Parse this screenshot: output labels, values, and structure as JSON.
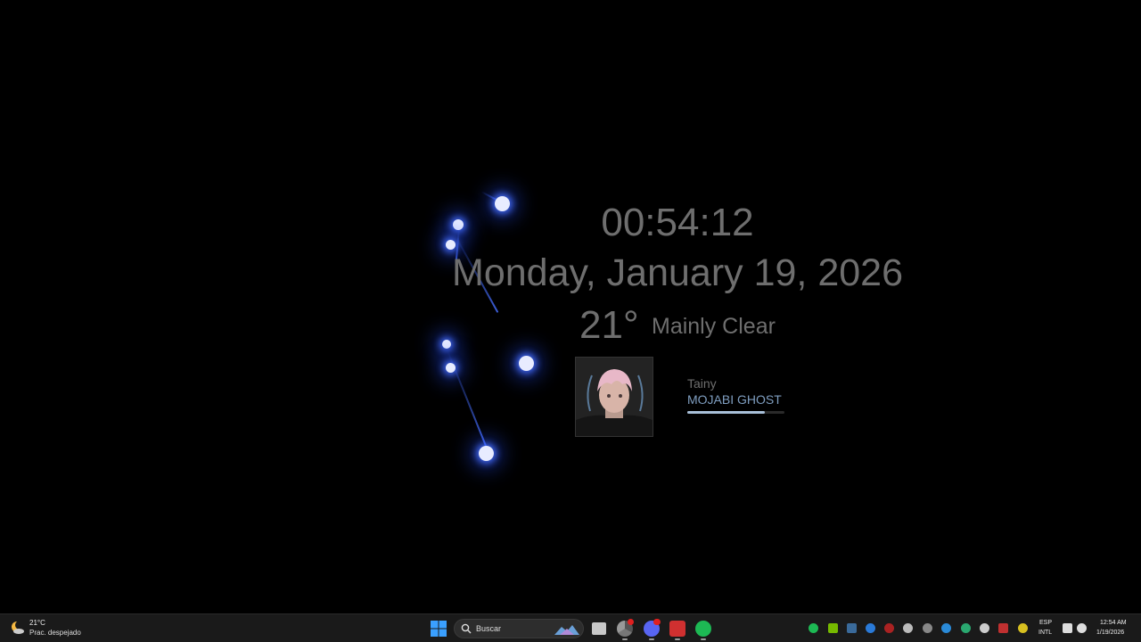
{
  "widget": {
    "time": "00:54:12",
    "date": "Monday, January 19, 2026",
    "weather_temp": "21°",
    "weather_desc": "Mainly Clear"
  },
  "now_playing": {
    "artist": "Tainy",
    "title": "MOJABI GHOST",
    "progress": 0.8
  },
  "taskbar": {
    "weather_temp": "21°C",
    "weather_cond": "Prac. despejado",
    "search_placeholder": "Buscar",
    "lang_top": "ESP",
    "lang_bottom": "INTL",
    "clock_time": "12:54 AM",
    "clock_date": "1/19/2026",
    "pinned_apps": [
      "file-explorer-icon",
      "chrome-icon",
      "discord-icon",
      "app-icon",
      "spotify-icon"
    ],
    "tray_icons": [
      "spotify-tray-icon",
      "nvidia-icon",
      "app-tray-icon",
      "bluetooth-icon",
      "tray-icon",
      "tray-icon",
      "tray-icon",
      "tray-icon",
      "defender-icon",
      "discord-tray-icon",
      "tray-icon",
      "microphone-icon",
      "network-icon",
      "volume-icon"
    ]
  },
  "colors": {
    "accent": "#1DB954",
    "glow": "#466eff",
    "track_title": "#7f9ec0"
  }
}
